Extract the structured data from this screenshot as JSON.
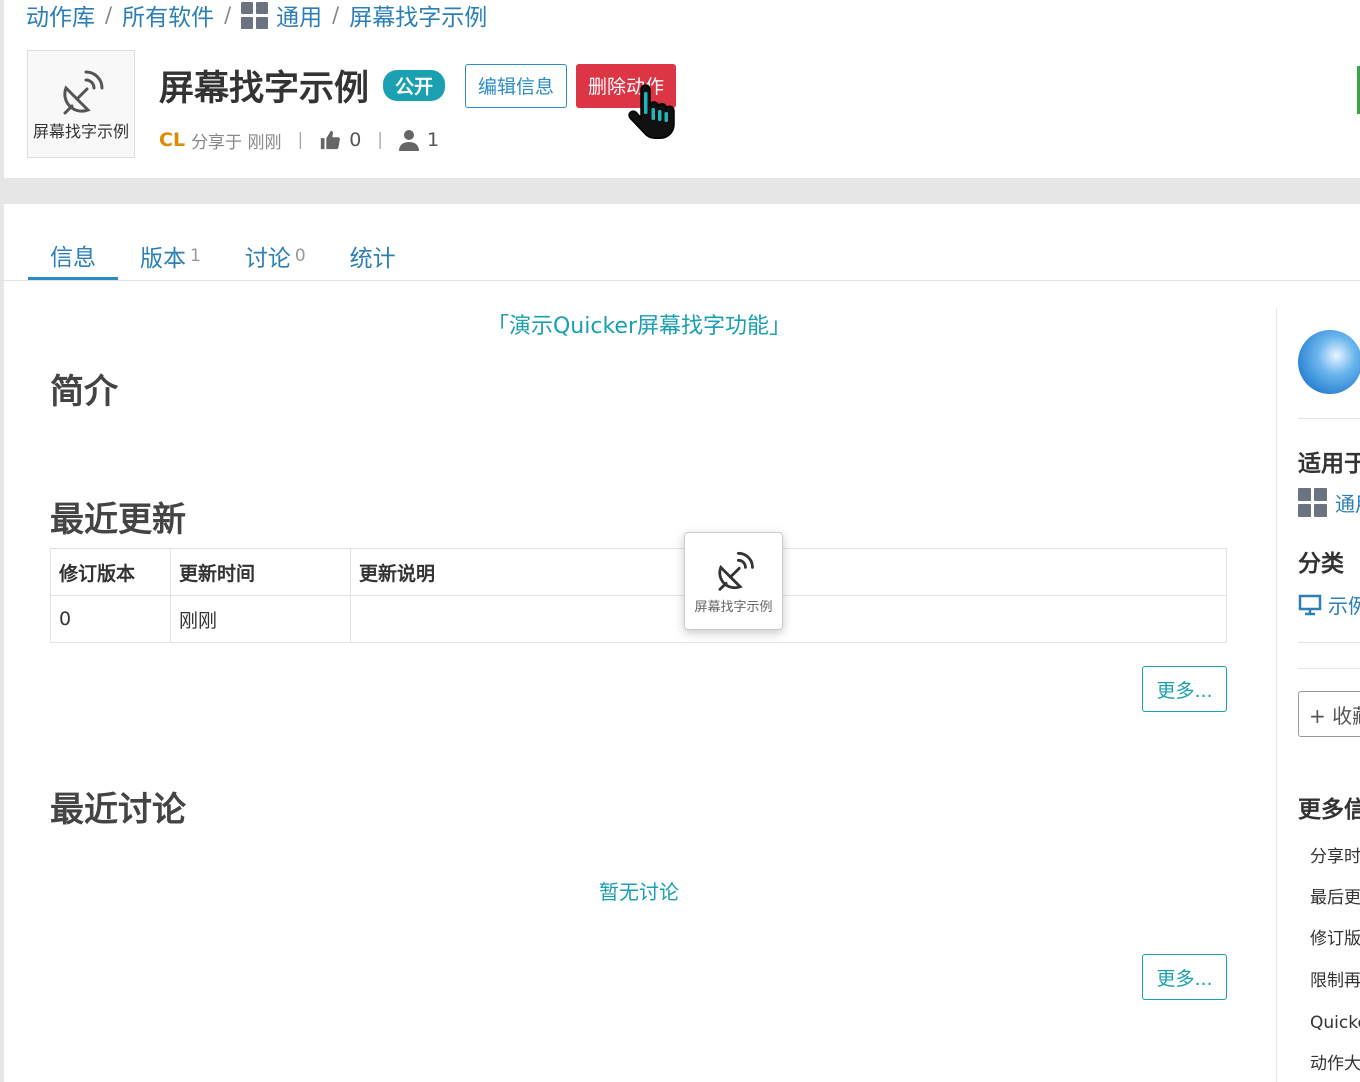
{
  "breadcrumb": {
    "items": [
      "动作库",
      "所有软件",
      "通用",
      "屏幕找字示例"
    ],
    "separator": "/"
  },
  "action": {
    "icon_label": "屏幕找字示例",
    "title": "屏幕找字示例",
    "visibility_badge": "公开",
    "edit_button": "编辑信息",
    "delete_button": "删除动作",
    "author": "CL",
    "shared_text": "分享于 刚刚",
    "likes": "0",
    "users": "1",
    "meta_separator": "|"
  },
  "tabs": [
    {
      "label": "信息",
      "count": ""
    },
    {
      "label": "版本",
      "count": "1"
    },
    {
      "label": "讨论",
      "count": "0"
    },
    {
      "label": "统计",
      "count": ""
    }
  ],
  "info": {
    "description_link": "「演示Quicker屏幕找字功能」",
    "intro_heading": "简介",
    "updates_heading": "最近更新",
    "updates_table": {
      "headers": [
        "修订版本",
        "更新时间",
        "更新说明"
      ],
      "rows": [
        [
          "0",
          "刚刚",
          ""
        ]
      ]
    },
    "more_button": "更多...",
    "discussion_heading": "最近讨论",
    "no_discussion": "暂无讨论",
    "discussion_more_button": "更多..."
  },
  "drag_tile": {
    "label": "屏幕找字示例"
  },
  "side": {
    "applies_heading": "适用于",
    "applies_item": "通用",
    "category_heading": "分类",
    "category_item": "示例",
    "collect_button": "+ 收藏",
    "more_info_heading": "更多信息",
    "info_items": [
      "分享时间",
      "最后更新",
      "修订版本",
      "限制再分享",
      "Quicker版本",
      "动作大小"
    ]
  },
  "colors": {
    "link": "#2b7fb5",
    "accent": "#1aa0b0",
    "danger": "#dc3545",
    "author": "#e08a00"
  },
  "icons": {
    "action_icon": "satellite-dish-icon",
    "likes": "thumbs-up-icon",
    "users": "user-icon",
    "software": "grid-icon",
    "category": "monitor-icon",
    "cursor": "hand-pointer-cursor"
  }
}
